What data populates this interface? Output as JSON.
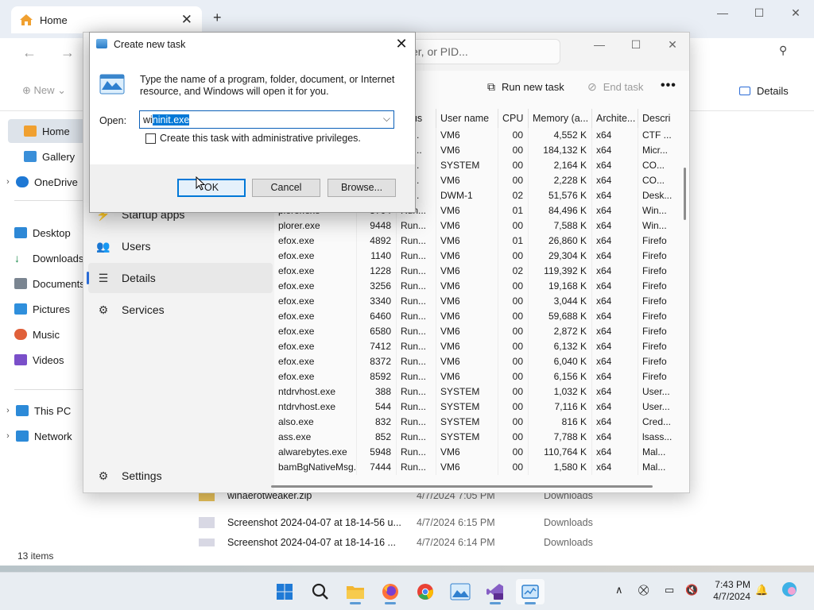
{
  "explorer": {
    "tab_title": "Home",
    "tab_close": "✕",
    "new_tab": "+",
    "controls": {
      "minimize": "—",
      "maximize": "☐",
      "close": "✕"
    },
    "new_label": "New",
    "status": "13 items",
    "sidebar": [
      {
        "label": "Home",
        "selected": true,
        "chevron": ""
      },
      {
        "label": "Gallery",
        "chevron": ""
      },
      {
        "label": "OneDrive",
        "chevron": "›"
      },
      {
        "label": "Desktop",
        "chevron": ""
      },
      {
        "label": "Downloads",
        "chevron": ""
      },
      {
        "label": "Documents",
        "chevron": ""
      },
      {
        "label": "Pictures",
        "chevron": ""
      },
      {
        "label": "Music",
        "chevron": ""
      },
      {
        "label": "Videos",
        "chevron": ""
      },
      {
        "label": "This PC",
        "chevron": "›"
      },
      {
        "label": "Network",
        "chevron": "›"
      }
    ],
    "files": [
      {
        "name": "winaerotweaker.zip",
        "date": "4/7/2024 7:05 PM",
        "location": "Downloads"
      },
      {
        "name": "Screenshot 2024-04-07 at 18-14-56 u...",
        "date": "4/7/2024 6:15 PM",
        "location": "Downloads"
      },
      {
        "name": "Screenshot 2024-04-07 at 18-14-16 ...",
        "date": "4/7/2024 6:14 PM",
        "location": "Downloads"
      }
    ]
  },
  "taskmgr": {
    "search_placeholder": "er, or PID...",
    "controls": {
      "minimize": "—",
      "maximize": "☐",
      "close": "✕"
    },
    "nav": [
      {
        "label": "Startup apps",
        "icon": "⚡"
      },
      {
        "label": "Users",
        "icon": "👥"
      },
      {
        "label": "Details",
        "icon": "☰",
        "active": true
      },
      {
        "label": "Services",
        "icon": "⚙"
      }
    ],
    "settings_label": "Settings",
    "toolbar": {
      "run_new_task": "Run new task",
      "end_task": "End task",
      "details": "Details",
      "more": "•••"
    },
    "columns": [
      "tatus",
      "User name",
      "CPU",
      "Memory (a...",
      "Archite...",
      "Descri"
    ],
    "rows": [
      [
        "",
        "",
        "un...",
        "VM6",
        "00",
        "4,552 K",
        "x64",
        "CTF ..."
      ],
      [
        "",
        "",
        "ot r...",
        "VM6",
        "00",
        "184,132 K",
        "x64",
        "Micr..."
      ],
      [
        "",
        "",
        "un...",
        "SYSTEM",
        "00",
        "2,164 K",
        "x64",
        "CO..."
      ],
      [
        "",
        "",
        "un...",
        "VM6",
        "00",
        "2,228 K",
        "x64",
        "CO..."
      ],
      [
        "",
        "",
        "un...",
        "DWM-1",
        "02",
        "51,576 K",
        "x64",
        "Desk..."
      ],
      [
        "plorer.exe",
        "5704",
        "Run...",
        "VM6",
        "01",
        "84,496 K",
        "x64",
        "Win..."
      ],
      [
        "plorer.exe",
        "9448",
        "Run...",
        "VM6",
        "00",
        "7,588 K",
        "x64",
        "Win..."
      ],
      [
        "efox.exe",
        "4892",
        "Run...",
        "VM6",
        "01",
        "26,860 K",
        "x64",
        "Firefo"
      ],
      [
        "efox.exe",
        "1140",
        "Run...",
        "VM6",
        "00",
        "29,304 K",
        "x64",
        "Firefo"
      ],
      [
        "efox.exe",
        "1228",
        "Run...",
        "VM6",
        "02",
        "119,392 K",
        "x64",
        "Firefo"
      ],
      [
        "efox.exe",
        "3256",
        "Run...",
        "VM6",
        "00",
        "19,168 K",
        "x64",
        "Firefo"
      ],
      [
        "efox.exe",
        "3340",
        "Run...",
        "VM6",
        "00",
        "3,044 K",
        "x64",
        "Firefo"
      ],
      [
        "efox.exe",
        "6460",
        "Run...",
        "VM6",
        "00",
        "59,688 K",
        "x64",
        "Firefo"
      ],
      [
        "efox.exe",
        "6580",
        "Run...",
        "VM6",
        "00",
        "2,872 K",
        "x64",
        "Firefo"
      ],
      [
        "efox.exe",
        "7412",
        "Run...",
        "VM6",
        "00",
        "6,132 K",
        "x64",
        "Firefo"
      ],
      [
        "efox.exe",
        "8372",
        "Run...",
        "VM6",
        "00",
        "6,040 K",
        "x64",
        "Firefo"
      ],
      [
        "efox.exe",
        "8592",
        "Run...",
        "VM6",
        "00",
        "6,156 K",
        "x64",
        "Firefo"
      ],
      [
        "ntdrvhost.exe",
        "388",
        "Run...",
        "SYSTEM",
        "00",
        "1,032 K",
        "x64",
        "User..."
      ],
      [
        "ntdrvhost.exe",
        "544",
        "Run...",
        "SYSTEM",
        "00",
        "7,116 K",
        "x64",
        "User..."
      ],
      [
        "also.exe",
        "832",
        "Run...",
        "SYSTEM",
        "00",
        "816 K",
        "x64",
        "Cred..."
      ],
      [
        "ass.exe",
        "852",
        "Run...",
        "SYSTEM",
        "00",
        "7,788 K",
        "x64",
        "lsass..."
      ],
      [
        "alwarebytes.exe",
        "5948",
        "Run...",
        "VM6",
        "00",
        "110,764 K",
        "x64",
        "Mal..."
      ],
      [
        "bamBgNativeMsg...",
        "7444",
        "Run...",
        "VM6",
        "00",
        "1,580 K",
        "x64",
        "Mal..."
      ]
    ]
  },
  "dialog": {
    "title": "Create new task",
    "close": "✕",
    "message": "Type the name of a program, folder, document, or Internet resource, and Windows will open it for you.",
    "open_label": "Open:",
    "open_value_plain": "wi",
    "open_value_selected": "ninit.exe",
    "dropdown_arrow": "⌵",
    "admin_label": "Create this task with administrative privileges.",
    "ok": "OK",
    "cancel": "Cancel",
    "browse": "Browse..."
  },
  "taskbar": {
    "apps": [
      "start-icon",
      "search-icon",
      "file-explorer-icon",
      "firefox-icon",
      "chrome-icon",
      "photos-icon",
      "visual-studio-icon",
      "task-manager-icon"
    ],
    "time": "7:43 PM",
    "date": "4/7/2024",
    "chevron": "∧"
  },
  "colors": {
    "accent": "#0078d7",
    "selection": "#0078d7",
    "taskbar": "#e8edf2"
  }
}
